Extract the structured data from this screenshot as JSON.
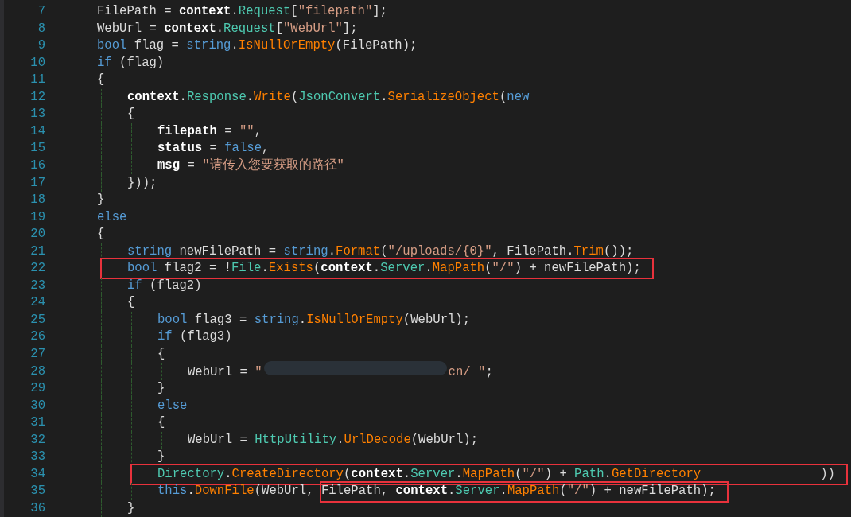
{
  "editor": {
    "lines": [
      {
        "number": "7",
        "tokens": [
          {
            "kind": "plain",
            "text": "FilePath = "
          },
          {
            "kind": "bold",
            "text": "context"
          },
          {
            "kind": "plain",
            "text": "."
          },
          {
            "kind": "type",
            "text": "Request"
          },
          {
            "kind": "plain",
            "text": "["
          },
          {
            "kind": "string",
            "text": "\"filepath\""
          },
          {
            "kind": "plain",
            "text": "];"
          }
        ]
      },
      {
        "number": "8",
        "tokens": [
          {
            "kind": "plain",
            "text": "WebUrl = "
          },
          {
            "kind": "bold",
            "text": "context"
          },
          {
            "kind": "plain",
            "text": "."
          },
          {
            "kind": "type",
            "text": "Request"
          },
          {
            "kind": "plain",
            "text": "["
          },
          {
            "kind": "string",
            "text": "\"WebUrl\""
          },
          {
            "kind": "plain",
            "text": "];"
          }
        ]
      },
      {
        "number": "9",
        "tokens": [
          {
            "kind": "keyword",
            "text": "bool"
          },
          {
            "kind": "plain",
            "text": " flag = "
          },
          {
            "kind": "keyword",
            "text": "string"
          },
          {
            "kind": "plain",
            "text": "."
          },
          {
            "kind": "method",
            "text": "IsNullOrEmpty"
          },
          {
            "kind": "plain",
            "text": "(FilePath);"
          }
        ]
      },
      {
        "number": "10",
        "tokens": [
          {
            "kind": "keyword",
            "text": "if"
          },
          {
            "kind": "plain",
            "text": " (flag)"
          }
        ]
      },
      {
        "number": "11",
        "tokens": [
          {
            "kind": "plain",
            "text": "{"
          }
        ],
        "children": [
          {
            "number": "12",
            "tokens": [
              {
                "kind": "bold",
                "text": "context"
              },
              {
                "kind": "plain",
                "text": "."
              },
              {
                "kind": "type",
                "text": "Response"
              },
              {
                "kind": "plain",
                "text": "."
              },
              {
                "kind": "method",
                "text": "Write"
              },
              {
                "kind": "plain",
                "text": "("
              },
              {
                "kind": "type",
                "text": "JsonConvert"
              },
              {
                "kind": "plain",
                "text": "."
              },
              {
                "kind": "method",
                "text": "SerializeObject"
              },
              {
                "kind": "plain",
                "text": "("
              },
              {
                "kind": "keyword",
                "text": "new"
              }
            ]
          },
          {
            "number": "13",
            "tokens": [
              {
                "kind": "plain",
                "text": "{"
              }
            ],
            "children": [
              {
                "number": "14",
                "tokens": [
                  {
                    "kind": "bold",
                    "text": "filepath"
                  },
                  {
                    "kind": "plain",
                    "text": " = "
                  },
                  {
                    "kind": "string",
                    "text": "\"\""
                  },
                  {
                    "kind": "plain",
                    "text": ","
                  }
                ]
              },
              {
                "number": "15",
                "tokens": [
                  {
                    "kind": "bold",
                    "text": "status"
                  },
                  {
                    "kind": "plain",
                    "text": " = "
                  },
                  {
                    "kind": "keyword",
                    "text": "false"
                  },
                  {
                    "kind": "plain",
                    "text": ","
                  }
                ]
              },
              {
                "number": "16",
                "tokens": [
                  {
                    "kind": "bold",
                    "text": "msg"
                  },
                  {
                    "kind": "plain",
                    "text": " = "
                  },
                  {
                    "kind": "string",
                    "text": "\"请传入您要获取的路径\""
                  }
                ]
              }
            ]
          },
          {
            "number": "17",
            "tokens": [
              {
                "kind": "plain",
                "text": "}));"
              }
            ]
          }
        ]
      },
      {
        "number": "18",
        "tokens": [
          {
            "kind": "plain",
            "text": "}"
          }
        ]
      },
      {
        "number": "19",
        "tokens": [
          {
            "kind": "keyword",
            "text": "else"
          }
        ]
      },
      {
        "number": "20",
        "tokens": [
          {
            "kind": "plain",
            "text": "{"
          }
        ],
        "children": [
          {
            "number": "21",
            "tokens": [
              {
                "kind": "keyword",
                "text": "string"
              },
              {
                "kind": "plain",
                "text": " newFilePath = "
              },
              {
                "kind": "keyword",
                "text": "string"
              },
              {
                "kind": "plain",
                "text": "."
              },
              {
                "kind": "method",
                "text": "Format"
              },
              {
                "kind": "plain",
                "text": "("
              },
              {
                "kind": "string",
                "text": "\"/uploads/{0}\""
              },
              {
                "kind": "plain",
                "text": ", FilePath."
              },
              {
                "kind": "method",
                "text": "Trim"
              },
              {
                "kind": "plain",
                "text": "());"
              }
            ]
          },
          {
            "number": "22",
            "boxed": [
              {
                "kind": "keyword",
                "text": "bool"
              },
              {
                "kind": "plain",
                "text": " flag2 = !"
              },
              {
                "kind": "type",
                "text": "File"
              },
              {
                "kind": "plain",
                "text": "."
              },
              {
                "kind": "method",
                "text": "Exists"
              },
              {
                "kind": "plain",
                "text": "("
              },
              {
                "kind": "bold",
                "text": "context"
              },
              {
                "kind": "plain",
                "text": "."
              },
              {
                "kind": "type",
                "text": "Server"
              },
              {
                "kind": "plain",
                "text": "."
              },
              {
                "kind": "method",
                "text": "MapPath"
              },
              {
                "kind": "plain",
                "text": "("
              },
              {
                "kind": "string",
                "text": "\"/\""
              },
              {
                "kind": "plain",
                "text": ") + newFilePath);"
              }
            ]
          },
          {
            "number": "23",
            "tokens": [
              {
                "kind": "keyword",
                "text": "if"
              },
              {
                "kind": "plain",
                "text": " (flag2)"
              }
            ]
          },
          {
            "number": "24",
            "tokens": [
              {
                "kind": "plain",
                "text": "{"
              }
            ],
            "children": [
              {
                "number": "25",
                "tokens": [
                  {
                    "kind": "keyword",
                    "text": "bool"
                  },
                  {
                    "kind": "plain",
                    "text": " flag3 = "
                  },
                  {
                    "kind": "keyword",
                    "text": "string"
                  },
                  {
                    "kind": "plain",
                    "text": "."
                  },
                  {
                    "kind": "method",
                    "text": "IsNullOrEmpty"
                  },
                  {
                    "kind": "plain",
                    "text": "(WebUrl);"
                  }
                ]
              },
              {
                "number": "26",
                "tokens": [
                  {
                    "kind": "keyword",
                    "text": "if"
                  },
                  {
                    "kind": "plain",
                    "text": " (flag3)"
                  }
                ]
              },
              {
                "number": "27",
                "tokens": [
                  {
                    "kind": "plain",
                    "text": "{"
                  }
                ],
                "children": [
                  {
                    "number": "28",
                    "tokens": [
                      {
                        "kind": "plain",
                        "text": "WebUrl = "
                      },
                      {
                        "kind": "string",
                        "text": "\""
                      },
                      {
                        "kind": "redacted"
                      },
                      {
                        "kind": "string",
                        "text": "cn/ \""
                      },
                      {
                        "kind": "plain",
                        "text": ";"
                      }
                    ]
                  }
                ]
              },
              {
                "number": "29",
                "tokens": [
                  {
                    "kind": "plain",
                    "text": "}"
                  }
                ]
              },
              {
                "number": "30",
                "tokens": [
                  {
                    "kind": "keyword",
                    "text": "else"
                  }
                ]
              },
              {
                "number": "31",
                "tokens": [
                  {
                    "kind": "plain",
                    "text": "{"
                  }
                ],
                "children": [
                  {
                    "number": "32",
                    "tokens": [
                      {
                        "kind": "plain",
                        "text": "WebUrl = "
                      },
                      {
                        "kind": "type",
                        "text": "HttpUtility"
                      },
                      {
                        "kind": "plain",
                        "text": "."
                      },
                      {
                        "kind": "method",
                        "text": "UrlDecode"
                      },
                      {
                        "kind": "plain",
                        "text": "(WebUrl);"
                      }
                    ]
                  }
                ]
              },
              {
                "number": "33",
                "tokens": [
                  {
                    "kind": "plain",
                    "text": "}"
                  }
                ]
              },
              {
                "number": "34",
                "boxed": [
                  {
                    "kind": "type",
                    "text": "Directory"
                  },
                  {
                    "kind": "plain",
                    "text": "."
                  },
                  {
                    "kind": "method",
                    "text": "CreateDirectory"
                  },
                  {
                    "kind": "plain",
                    "text": "("
                  },
                  {
                    "kind": "bold",
                    "text": "context"
                  },
                  {
                    "kind": "plain",
                    "text": "."
                  },
                  {
                    "kind": "type",
                    "text": "Server"
                  },
                  {
                    "kind": "plain",
                    "text": "."
                  },
                  {
                    "kind": "method",
                    "text": "MapPath"
                  },
                  {
                    "kind": "plain",
                    "text": "("
                  },
                  {
                    "kind": "string",
                    "text": "\"/\""
                  },
                  {
                    "kind": "plain",
                    "text": ") + "
                  },
                  {
                    "kind": "type",
                    "text": "Path"
                  },
                  {
                    "kind": "plain",
                    "text": "."
                  },
                  {
                    "kind": "method",
                    "text": "GetDirectory"
                  },
                  {
                    "kind": "gap"
                  },
                  {
                    "kind": "plain",
                    "text": "))"
                  }
                ]
              },
              {
                "number": "35",
                "tokens": [
                  {
                    "kind": "keyword",
                    "text": "this"
                  },
                  {
                    "kind": "plain",
                    "text": "."
                  },
                  {
                    "kind": "method",
                    "text": "DownFile"
                  },
                  {
                    "kind": "plain",
                    "text": "(WebUrl, "
                  }
                ],
                "boxed": [
                  {
                    "kind": "plain",
                    "text": "FilePath, "
                  },
                  {
                    "kind": "bold",
                    "text": "context"
                  },
                  {
                    "kind": "plain",
                    "text": "."
                  },
                  {
                    "kind": "type",
                    "text": "Server"
                  },
                  {
                    "kind": "plain",
                    "text": "."
                  },
                  {
                    "kind": "method",
                    "text": "MapPath"
                  },
                  {
                    "kind": "plain",
                    "text": "("
                  },
                  {
                    "kind": "string",
                    "text": "\"/\""
                  },
                  {
                    "kind": "plain",
                    "text": ") + newFilePath);"
                  }
                ]
              }
            ]
          },
          {
            "number": "36",
            "tokens": [
              {
                "kind": "plain",
                "text": "}"
              }
            ]
          }
        ]
      }
    ]
  }
}
